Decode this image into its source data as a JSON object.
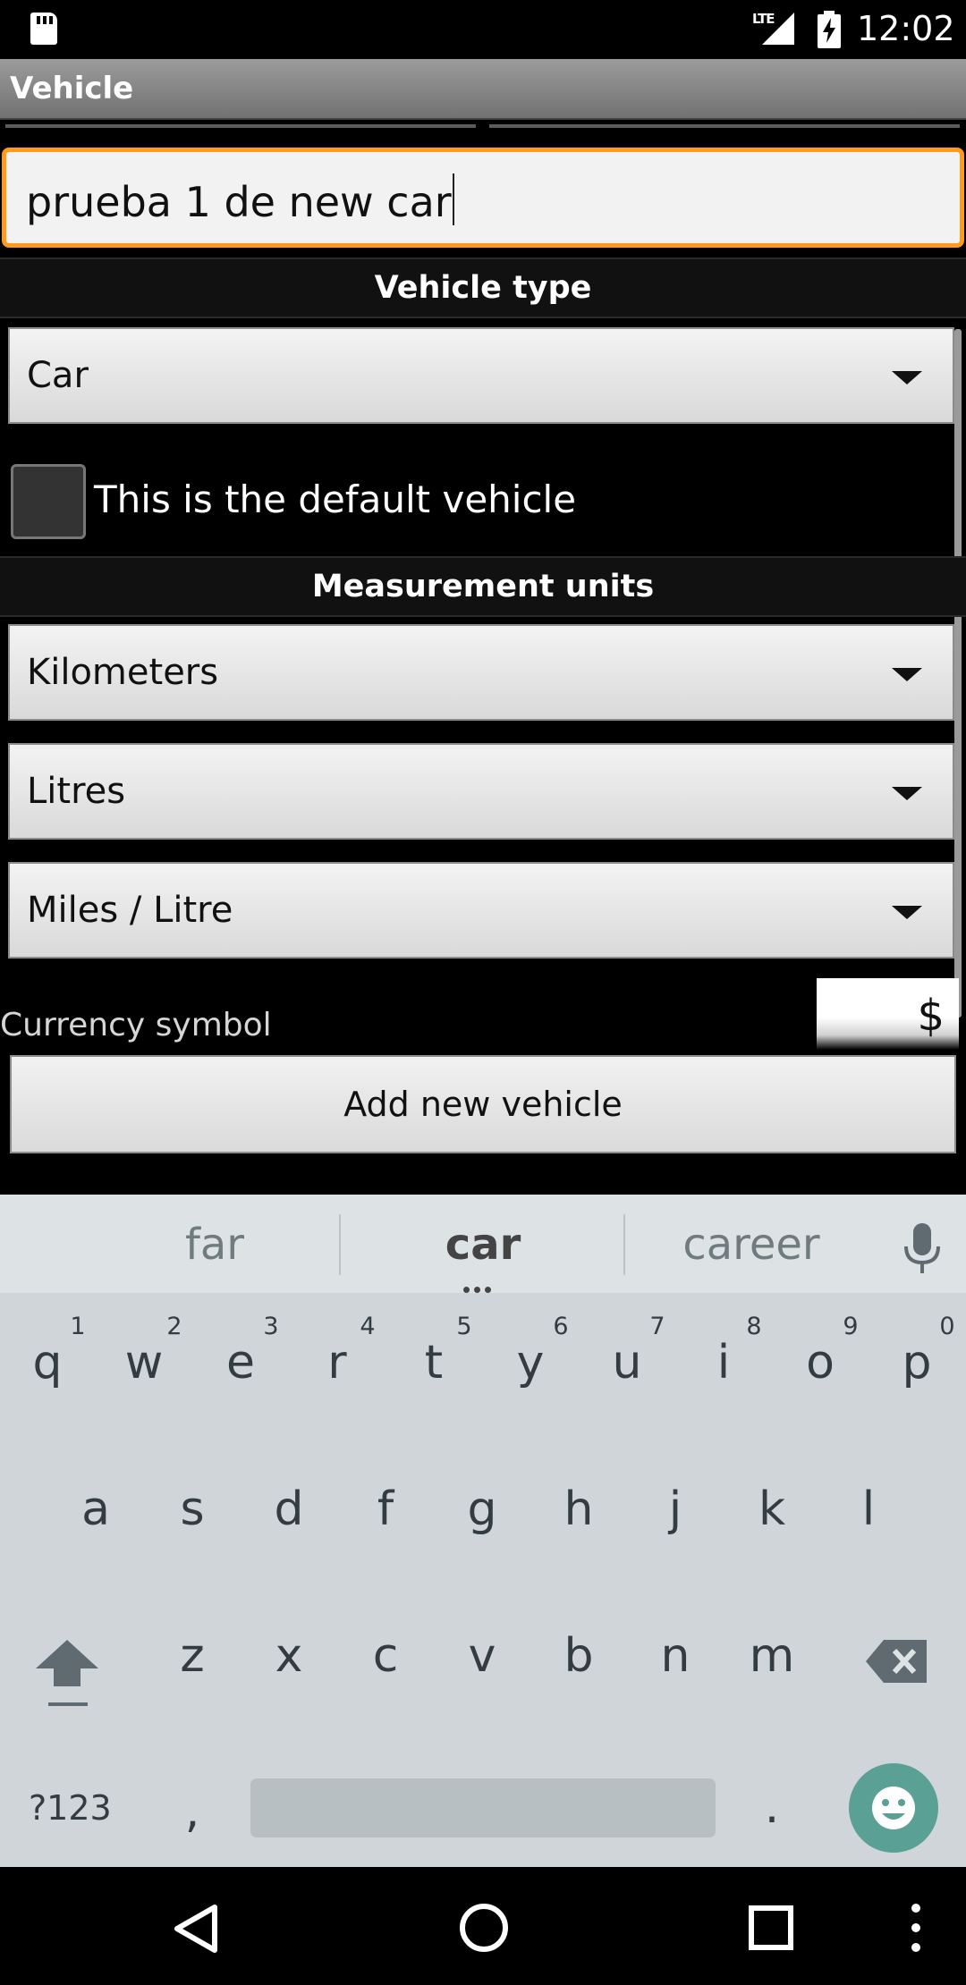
{
  "status_bar": {
    "network_label": "LTE",
    "time": "12:02"
  },
  "action_bar": {
    "title": "Vehicle"
  },
  "name_input": {
    "value": "prueba 1 de new car"
  },
  "sections": {
    "vehicle_type": "Vehicle type",
    "measurement_units": "Measurement units"
  },
  "vehicle_type": {
    "selected": "Car"
  },
  "default_vehicle": {
    "label": "This is the default vehicle",
    "checked": false
  },
  "units": {
    "distance": "Kilometers",
    "volume": "Litres",
    "consumption": "Miles / Litre"
  },
  "currency": {
    "label": "Currency symbol",
    "value": "$"
  },
  "add_button": {
    "label": "Add new vehicle"
  },
  "keyboard": {
    "suggestions": [
      "far",
      "car",
      "career"
    ],
    "row1": [
      "q",
      "w",
      "e",
      "r",
      "t",
      "y",
      "u",
      "i",
      "o",
      "p"
    ],
    "row1_hints": [
      "1",
      "2",
      "3",
      "4",
      "5",
      "6",
      "7",
      "8",
      "9",
      "0"
    ],
    "row2": [
      "a",
      "s",
      "d",
      "f",
      "g",
      "h",
      "j",
      "k",
      "l"
    ],
    "row3": [
      "z",
      "x",
      "c",
      "v",
      "b",
      "n",
      "m"
    ],
    "symbols_label": "?123",
    "comma": ",",
    "period": "."
  },
  "colors": {
    "focus_border": "#ff9a1a",
    "emoji_button": "#5aa095",
    "keyboard_bg": "#cfd5d8"
  },
  "icons": [
    "sd-card-icon",
    "lte-signal-icon",
    "battery-charging-icon",
    "dropdown-icon",
    "mic-icon",
    "shift-icon",
    "backspace-icon",
    "emoji-icon",
    "back-icon",
    "home-icon",
    "recents-icon",
    "overflow-menu-icon"
  ]
}
